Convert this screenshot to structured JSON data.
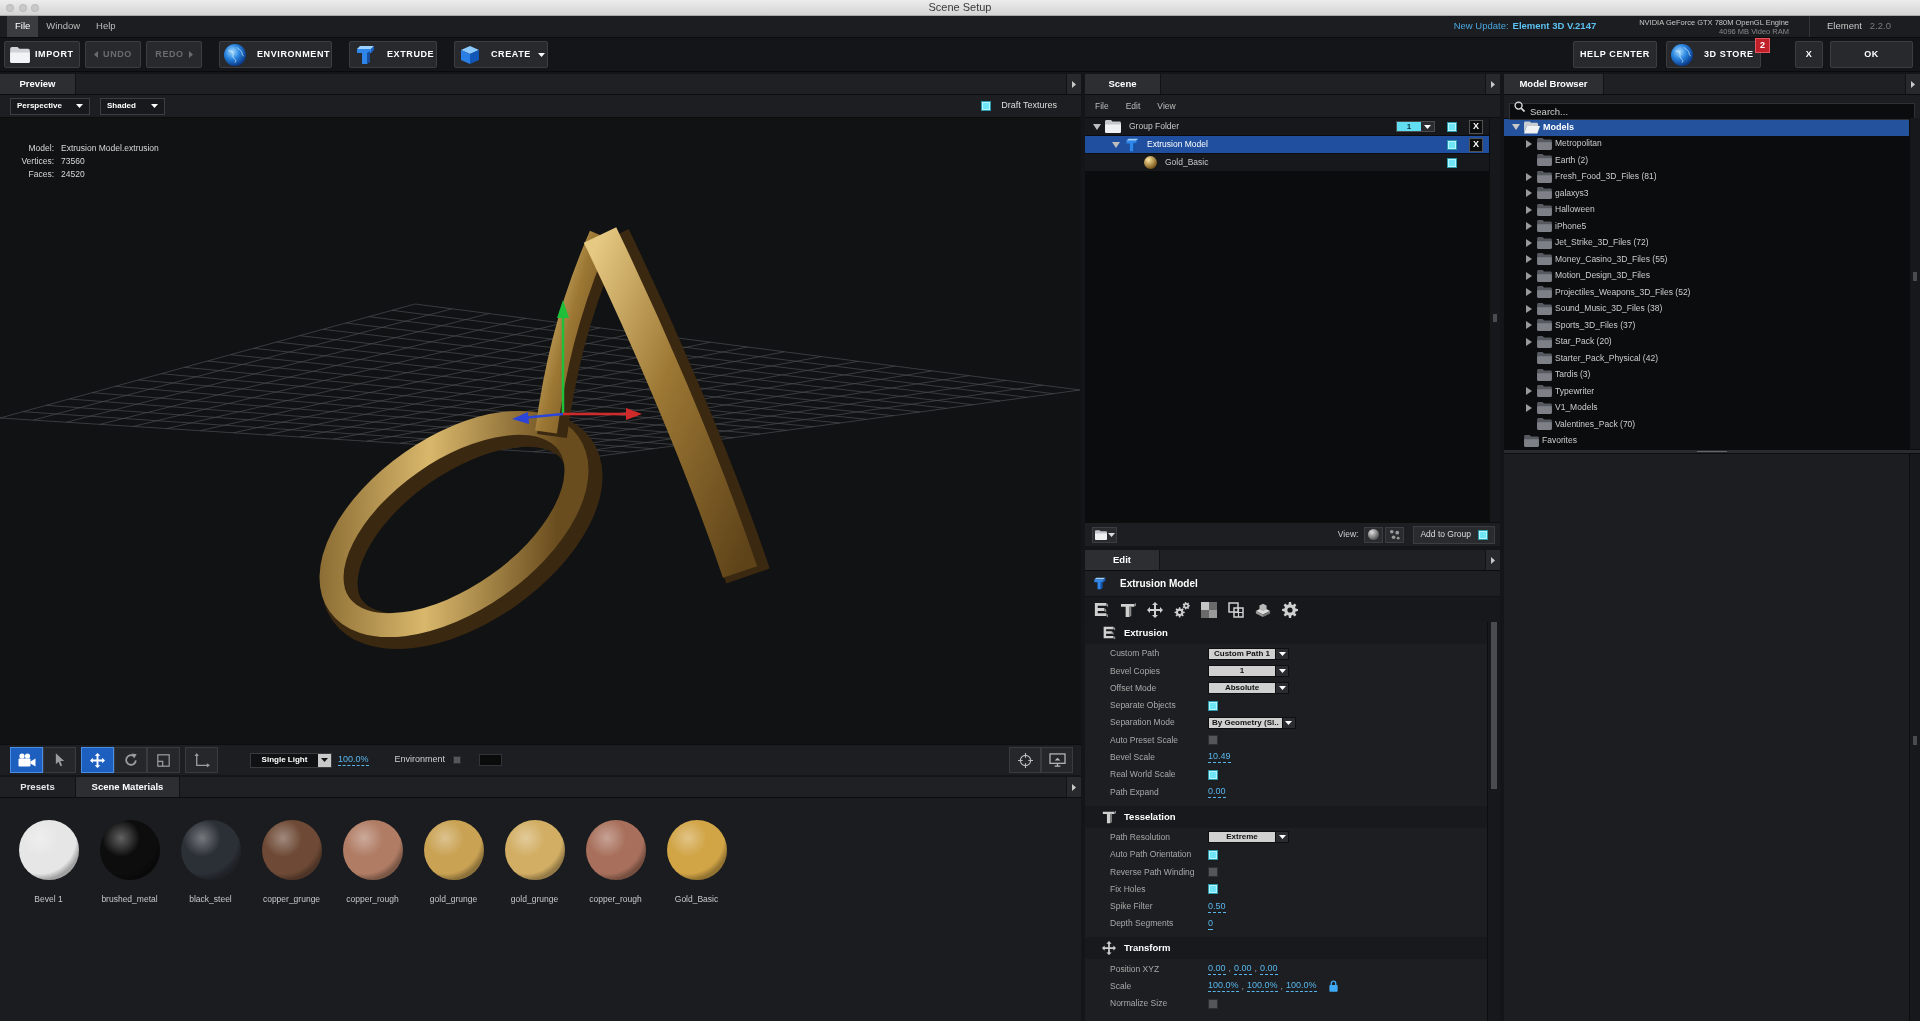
{
  "window": {
    "title": "Scene Setup"
  },
  "menu_bar": {
    "items": [
      {
        "label": "File",
        "selected": true
      },
      {
        "label": "Window",
        "selected": false
      },
      {
        "label": "Help",
        "selected": false
      }
    ],
    "update_label": "New Update:",
    "update_version": "Element 3D V.2147",
    "gpu": "NVIDIA GeForce GTX 780M OpenGL Engine",
    "video_ram": "4096 MB Video RAM",
    "product": "Element",
    "version": "2.2.0"
  },
  "toolbar": {
    "import": {
      "label": "IMPORT"
    },
    "undo": {
      "label": "UNDO",
      "disabled": true
    },
    "redo": {
      "label": "REDO",
      "disabled": true
    },
    "environment": {
      "label": "ENVIRONMENT"
    },
    "extrude": {
      "label": "EXTRUDE"
    },
    "create": {
      "label": "CREATE"
    },
    "help_center": {
      "label": "HELP CENTER"
    },
    "store": {
      "label": "3D STORE",
      "badge": "2"
    },
    "close": {
      "label": "X"
    },
    "ok": {
      "label": "OK"
    }
  },
  "preview": {
    "tab": "Preview",
    "camera_view": "Perspective",
    "shading": "Shaded",
    "draft_textures": {
      "label": "Draft Textures",
      "checked": true
    },
    "stats": [
      {
        "label": "Model:",
        "value": "Extrusion Model.extrusion"
      },
      {
        "label": "Vertices:",
        "value": "73560"
      },
      {
        "label": "Faces:",
        "value": "24520"
      }
    ],
    "tool_groups": [
      {
        "tools": [
          {
            "kind": "camera",
            "selected": true
          },
          {
            "kind": "pointer",
            "selected": false
          }
        ]
      },
      {
        "tools": [
          {
            "kind": "move",
            "selected": true
          },
          {
            "kind": "rotate",
            "selected": false
          },
          {
            "kind": "scale",
            "selected": false
          }
        ]
      },
      {
        "tools": [
          {
            "kind": "axis",
            "selected": false
          }
        ]
      }
    ],
    "lighting": "Single Light",
    "light_intensity": "100.0%",
    "environment": {
      "label": "Environment",
      "checked": false
    }
  },
  "materials": {
    "tabs": [
      {
        "label": "Presets",
        "selected": false
      },
      {
        "label": "Scene Materials",
        "selected": true
      }
    ],
    "items": [
      {
        "name": "Bevel 1",
        "color": "#e6e6e6"
      },
      {
        "name": "brushed_metal",
        "color": "#0d0d0e"
      },
      {
        "name": "black_steel",
        "color": "#2b2f36"
      },
      {
        "name": "copper_grunge",
        "color": "#6e4a36"
      },
      {
        "name": "copper_rough",
        "color": "#b07c64"
      },
      {
        "name": "gold_grunge",
        "color": "#c9a253"
      },
      {
        "name": "gold_grunge",
        "color": "#d2ae64"
      },
      {
        "name": "copper_rough",
        "color": "#a8705c"
      },
      {
        "name": "Gold_Basic",
        "color": "#d1a446"
      }
    ]
  },
  "scene": {
    "tab": "Scene",
    "menu": [
      "File",
      "Edit",
      "View"
    ],
    "tree": [
      {
        "label": "Group Folder",
        "kind": "folder",
        "expanded": true,
        "selected": false,
        "checked": true,
        "count": "1",
        "delete_label": "X",
        "children": [
          {
            "label": "Extrusion Model",
            "kind": "model",
            "expanded": true,
            "selected": true,
            "checked": true,
            "delete_label": "X",
            "children": [
              {
                "label": "Gold_Basic",
                "kind": "material",
                "selected": false,
                "checked": true
              }
            ]
          }
        ]
      }
    ],
    "view_label": "View:",
    "add_to_group": {
      "label": "Add to Group",
      "checked": true
    }
  },
  "edit": {
    "tab": "Edit",
    "object": "Extrusion Model",
    "sections": [
      {
        "title": "Extrusion",
        "kind": "extrusion",
        "rows": [
          {
            "label": "Custom Path",
            "kind": "dropdown",
            "value": "Custom Path 1"
          },
          {
            "label": "Bevel Copies",
            "kind": "dropdown",
            "value": "1"
          },
          {
            "label": "Offset Mode",
            "kind": "dropdown",
            "value": "Absolute"
          },
          {
            "label": "Separate Objects",
            "kind": "checkbox",
            "checked": true
          },
          {
            "label": "Separation Mode",
            "kind": "dropdown",
            "value": "By Geometry (Sl.."
          },
          {
            "label": "Auto Preset Scale",
            "kind": "checkbox",
            "checked": false
          },
          {
            "label": "Bevel Scale",
            "kind": "number",
            "value": "10.49"
          },
          {
            "label": "Real World Scale",
            "kind": "checkbox",
            "checked": true
          },
          {
            "label": "Path Expand",
            "kind": "number",
            "value": "0.00"
          }
        ]
      },
      {
        "title": "Tesselation",
        "kind": "tesselation",
        "rows": [
          {
            "label": "Path Resolution",
            "kind": "dropdown",
            "value": "Extreme"
          },
          {
            "label": "Auto Path Orientation",
            "kind": "checkbox",
            "checked": true
          },
          {
            "label": "Reverse Path Winding",
            "kind": "checkbox",
            "checked": false
          },
          {
            "label": "Fix Holes",
            "kind": "checkbox",
            "checked": true
          },
          {
            "label": "Spike Filter",
            "kind": "number",
            "value": "0.50"
          },
          {
            "label": "Depth Segments",
            "kind": "number",
            "value": "0"
          }
        ]
      },
      {
        "title": "Transform",
        "kind": "transform",
        "rows": [
          {
            "label": "Position XYZ",
            "kind": "vector",
            "values": [
              "0.00",
              "0.00",
              "0.00"
            ],
            "separators": [
              ",",
              ","
            ]
          },
          {
            "label": "Scale",
            "kind": "vector",
            "values": [
              "100.0%",
              "100.0%",
              "100.0%"
            ],
            "separators": [
              ",",
              ","
            ],
            "locked": true
          },
          {
            "label": "Normalize Size",
            "kind": "checkbox",
            "checked": false
          }
        ]
      }
    ]
  },
  "model_browser": {
    "tab": "Model Browser",
    "search": {
      "placeholder": "Search..."
    },
    "tree": [
      {
        "label": "Models",
        "expandable": true,
        "expanded": true,
        "selected": true,
        "children": [
          {
            "label": "Metropolitan",
            "expandable": true,
            "expanded": false,
            "selected": false
          },
          {
            "label": "Earth (2)",
            "expandable": false,
            "expanded": false,
            "selected": false
          },
          {
            "label": "Fresh_Food_3D_Files (81)",
            "expandable": true,
            "expanded": false,
            "selected": false
          },
          {
            "label": "galaxys3",
            "expandable": true,
            "expanded": false,
            "selected": false
          },
          {
            "label": "Halloween",
            "expandable": true,
            "expanded": false,
            "selected": false
          },
          {
            "label": "iPhone5",
            "expandable": true,
            "expanded": false,
            "selected": false
          },
          {
            "label": "Jet_Strike_3D_Files (72)",
            "expandable": true,
            "expanded": false,
            "selected": false
          },
          {
            "label": "Money_Casino_3D_Files (55)",
            "expandable": true,
            "expanded": false,
            "selected": false
          },
          {
            "label": "Motion_Design_3D_Files",
            "expandable": true,
            "expanded": false,
            "selected": false
          },
          {
            "label": "Projectiles_Weapons_3D_Files (52)",
            "expandable": true,
            "expanded": false,
            "selected": false
          },
          {
            "label": "Sound_Music_3D_Files (38)",
            "expandable": true,
            "expanded": false,
            "selected": false
          },
          {
            "label": "Sports_3D_Files (37)",
            "expandable": true,
            "expanded": false,
            "selected": false
          },
          {
            "label": "Star_Pack (20)",
            "expandable": true,
            "expanded": false,
            "selected": false
          },
          {
            "label": "Starter_Pack_Physical (42)",
            "expandable": false,
            "expanded": false,
            "selected": false
          },
          {
            "label": "Tardis (3)",
            "expandable": false,
            "expanded": false,
            "selected": false
          },
          {
            "label": "Typewriter",
            "expandable": true,
            "expanded": false,
            "selected": false
          },
          {
            "label": "V1_Models",
            "expandable": true,
            "expanded": false,
            "selected": false
          },
          {
            "label": "Valentines_Pack (70)",
            "expandable": false,
            "expanded": false,
            "selected": false
          }
        ]
      },
      {
        "label": "Favorites",
        "expandable": false,
        "expanded": false,
        "selected": false
      }
    ]
  }
}
